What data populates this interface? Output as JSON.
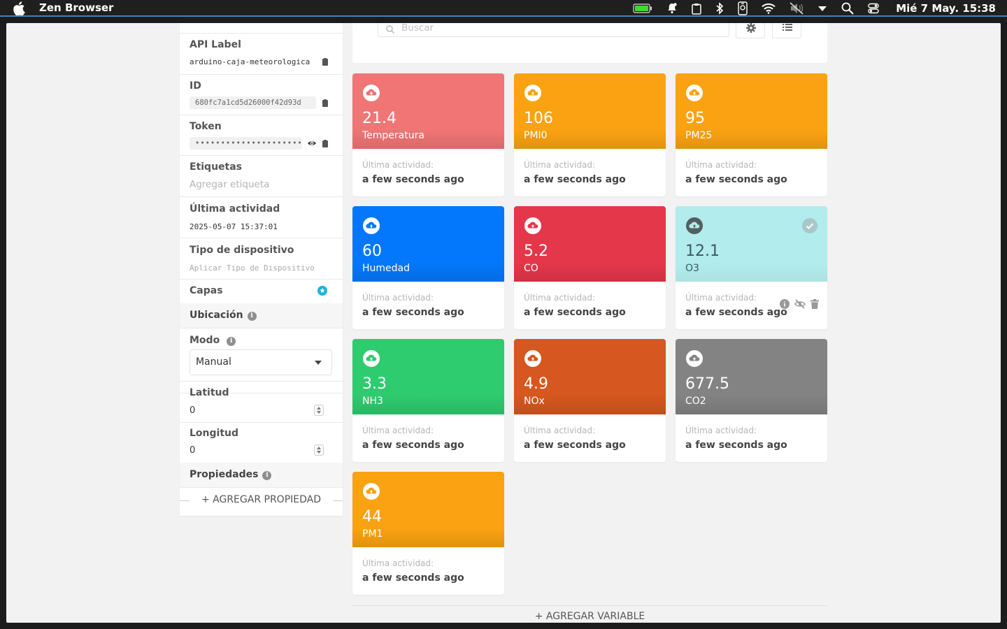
{
  "menubar": {
    "app_name": "Zen Browser",
    "clock": "Mié 7 May. 15:38",
    "accent_color": "#3b82c4",
    "tray_icons": [
      "battery-icon",
      "notification-bell-icon",
      "clipboard-icon",
      "bluetooth-icon",
      "phone-icon",
      "wifi-icon",
      "volume-muted-icon",
      "dropdown-icon",
      "search-icon",
      "control-center-icon"
    ]
  },
  "sidebar": {
    "api_label": {
      "label": "API Label",
      "value": "arduino-caja-meteorologica"
    },
    "id": {
      "label": "ID",
      "value": "680fc7a1cd5d26000f42d93d"
    },
    "token": {
      "label": "Token",
      "value": "••••••••••••••••••••••"
    },
    "tags": {
      "label": "Etiquetas",
      "placeholder": "Agregar etiqueta"
    },
    "last_activity": {
      "label": "Última actividad",
      "value": "2025-05-07 15:37:01"
    },
    "device_type": {
      "label": "Tipo de dispositivo",
      "placeholder": "Aplicar Tipo de Dispositivo"
    },
    "layers": {
      "label": "Capas"
    },
    "location": {
      "label": "Ubicación"
    },
    "mode": {
      "label": "Modo",
      "selected": "Manual"
    },
    "latitude": {
      "label": "Latitud",
      "value": "0"
    },
    "longitude": {
      "label": "Longitud",
      "value": "0"
    },
    "properties": {
      "label": "Propiedades"
    },
    "add_property": "+ AGREGAR PROPIEDAD"
  },
  "search": {
    "placeholder": "Buscar"
  },
  "variables": [
    {
      "value": "21.4",
      "name": "Temperatura",
      "last_activity_label": "Última actividad:",
      "last_activity": "a few seconds ago",
      "color": "#f17575"
    },
    {
      "value": "106",
      "name": "PMI0",
      "last_activity_label": "Última actividad:",
      "last_activity": "a few seconds ago",
      "color": "#fba212"
    },
    {
      "value": "95",
      "name": "PM25",
      "last_activity_label": "Última actividad:",
      "last_activity": "a few seconds ago",
      "color": "#fba212"
    },
    {
      "value": "60",
      "name": "Humedad",
      "last_activity_label": "Última actividad:",
      "last_activity": "a few seconds ago",
      "color": "#0378fc"
    },
    {
      "value": "5.2",
      "name": "CO",
      "last_activity_label": "Última actividad:",
      "last_activity": "a few seconds ago",
      "color": "#e5374a"
    },
    {
      "value": "12.1",
      "name": "O3",
      "last_activity_label": "Última actividad:",
      "last_activity": "a few seconds ago",
      "color": "#b2ecec"
    },
    {
      "value": "3.3",
      "name": "NH3",
      "last_activity_label": "Última actividad:",
      "last_activity": "a few seconds ago",
      "color": "#2ecb6f"
    },
    {
      "value": "4.9",
      "name": "NOx",
      "last_activity_label": "Última actividad:",
      "last_activity": "a few seconds ago",
      "color": "#d6571f"
    },
    {
      "value": "677.5",
      "name": "CO2",
      "last_activity_label": "Última actividad:",
      "last_activity": "a few seconds ago",
      "color": "#838383"
    },
    {
      "value": "44",
      "name": "PM1",
      "last_activity_label": "Última actividad:",
      "last_activity": "a few seconds ago",
      "color": "#fba212"
    }
  ],
  "add_variable": "+ AGREGAR VARIABLE"
}
